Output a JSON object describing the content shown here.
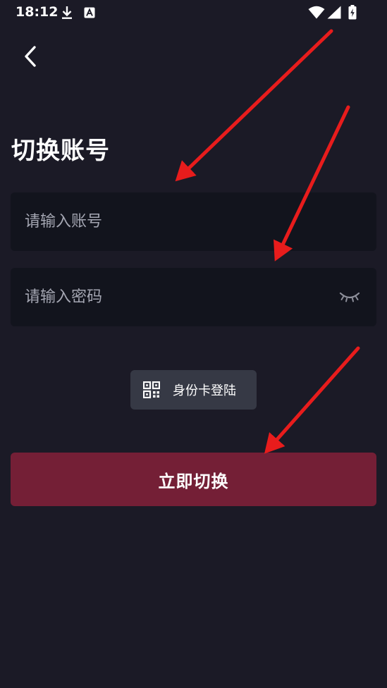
{
  "status_bar": {
    "time": "18:12"
  },
  "header": {
    "back_icon": "chevron-left-icon"
  },
  "page": {
    "title": "切换账号"
  },
  "form": {
    "account_placeholder": "请输入账号",
    "account_value": "",
    "password_placeholder": "请输入密码",
    "password_value": "",
    "password_toggle_icon": "eye-closed-icon"
  },
  "id_login": {
    "label": "身份卡登陆",
    "icon": "qr-code-icon"
  },
  "submit": {
    "label": "立即切换"
  },
  "colors": {
    "background": "#1b1a26",
    "field_background": "#12141d",
    "secondary_button": "#363945",
    "primary_button": "#741f36",
    "annotation_arrow": "#e81c1c"
  }
}
